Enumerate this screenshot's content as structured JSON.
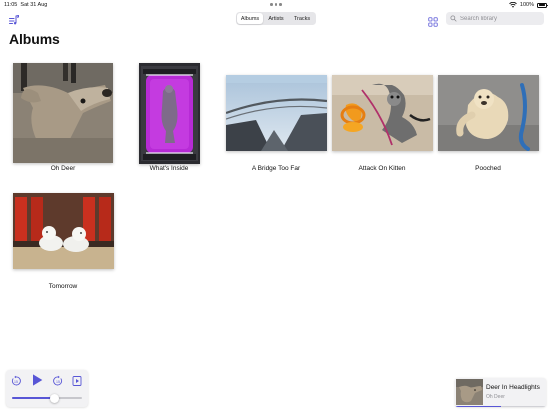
{
  "status": {
    "time": "11:05",
    "date": "Sat 31 Aug",
    "battery": "100%"
  },
  "toolbar": {
    "menu_icon": "music-list-icon",
    "segments": [
      "Albums",
      "Artists",
      "Tracks"
    ],
    "active_segment": "Albums",
    "grid_icon": "grid-view-icon",
    "search_placeholder": "Search library",
    "search_value": ""
  },
  "page_title": "Albums",
  "albums": [
    {
      "title": "Oh Deer"
    },
    {
      "title": "What's Inside"
    },
    {
      "title": "A Bridge Too Far"
    },
    {
      "title": "Attack On Kitten"
    },
    {
      "title": "Pooched"
    },
    {
      "title": "Tomorrow"
    }
  ],
  "player": {
    "icons": [
      "skip-back-15-icon",
      "play-icon",
      "skip-forward-15-icon",
      "queue-icon"
    ],
    "position_fraction": 0.6
  },
  "now_playing": {
    "title": "Deer In Headlights",
    "artist": "Oh Deer",
    "progress_fraction": 0.5
  },
  "colors": {
    "accent": "#5856d6",
    "background": "#ffffff",
    "secondary_text": "#8e8e93"
  }
}
